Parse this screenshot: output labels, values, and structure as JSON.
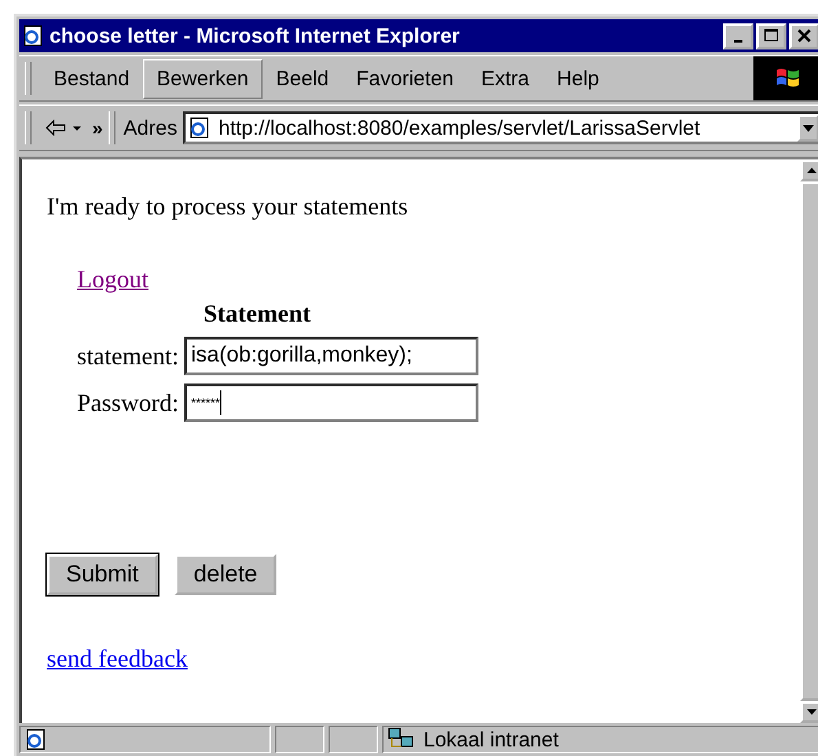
{
  "window": {
    "title": "choose letter - Microsoft Internet Explorer"
  },
  "menu": [
    {
      "label": "Bestand",
      "selected": false
    },
    {
      "label": "Bewerken",
      "selected": true
    },
    {
      "label": "Beeld",
      "selected": false
    },
    {
      "label": "Favorieten",
      "selected": false
    },
    {
      "label": "Extra",
      "selected": false
    },
    {
      "label": "Help",
      "selected": false
    }
  ],
  "toolbar": {
    "more": "»",
    "address_label": "Adres",
    "address": "http://localhost:8080/examples/servlet/LarissaServlet"
  },
  "page": {
    "intro": "I'm ready to process your statements",
    "logout": "Logout",
    "form_title": "Statement",
    "fields": [
      {
        "label": "statement:",
        "value": "isa(ob:gorilla,monkey);"
      },
      {
        "label": "Password:",
        "value": "******"
      }
    ],
    "buttons": [
      {
        "label": "Submit",
        "selected": true
      },
      {
        "label": "delete",
        "selected": false
      }
    ],
    "feedback": "send feedback"
  },
  "status_bar": {
    "zone": "Lokaal intranet"
  }
}
